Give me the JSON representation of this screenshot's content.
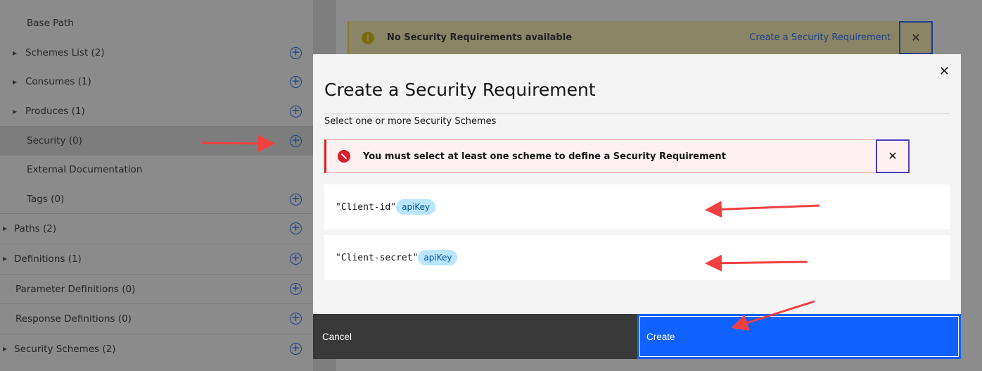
{
  "sidebar": {
    "items": [
      {
        "label": "Base Path",
        "caret": false,
        "plus": false
      },
      {
        "label": "Schemes List (2)",
        "caret": true,
        "plus": true
      },
      {
        "label": "Consumes (1)",
        "caret": true,
        "plus": true
      },
      {
        "label": "Produces (1)",
        "caret": true,
        "plus": true
      },
      {
        "label": "Security (0)",
        "caret": false,
        "plus": true,
        "selected": true
      },
      {
        "label": "External Documentation",
        "caret": false,
        "plus": false
      },
      {
        "label": "Tags (0)",
        "caret": false,
        "plus": true
      },
      {
        "label": "Paths (2)",
        "caret": true,
        "plus": true,
        "top": true
      },
      {
        "label": "Definitions (1)",
        "caret": true,
        "plus": true,
        "top": true
      },
      {
        "label": "Parameter Definitions (0)",
        "caret": false,
        "plus": true,
        "top": true
      },
      {
        "label": "Response Definitions (0)",
        "caret": false,
        "plus": true,
        "top": true
      },
      {
        "label": "Security Schemes (2)",
        "caret": true,
        "plus": true,
        "top": true
      }
    ]
  },
  "warning": {
    "text": "No Security Requirements available",
    "link": "Create a Security Requirement",
    "close": "✕"
  },
  "modal": {
    "title": "Create a Security Requirement",
    "subtitle": "Select one or more Security Schemes",
    "error": "You must select at least one scheme to define a Security Requirement",
    "close": "✕",
    "schemes": [
      {
        "name": "\"Client-id\"",
        "type": "apiKey"
      },
      {
        "name": "\"Client-secret\"",
        "type": "apiKey"
      }
    ],
    "cancel": "Cancel",
    "create": "Create"
  },
  "colors": {
    "primary": "#0f62fe",
    "error": "#da1e28",
    "tag_bg": "#bae6ff",
    "annotation": "#f04040"
  }
}
